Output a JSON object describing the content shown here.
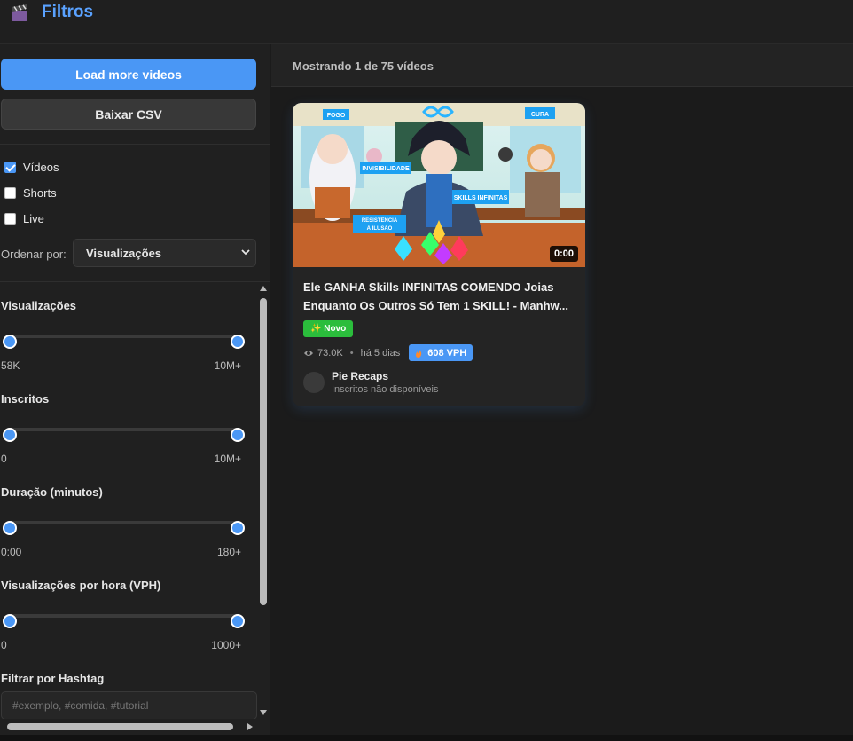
{
  "header": {
    "title": "Filtros",
    "icon": "clapperboard-icon"
  },
  "sidebar": {
    "load_more_label": "Load more videos",
    "download_csv_label": "Baixar CSV",
    "types": [
      {
        "label": "Vídeos",
        "checked": true
      },
      {
        "label": "Shorts",
        "checked": false
      },
      {
        "label": "Live",
        "checked": false
      }
    ],
    "sort": {
      "label": "Ordenar por:",
      "value": "Visualizações"
    },
    "filters": [
      {
        "title": "Visualizações",
        "min": "58K",
        "max": "10M+"
      },
      {
        "title": "Inscritos",
        "min": "0",
        "max": "10M+"
      },
      {
        "title": "Duração (minutos)",
        "min": "0:00",
        "max": "180+"
      },
      {
        "title": "Visualizações por hora (VPH)",
        "min": "0",
        "max": "1000+"
      }
    ],
    "hashtag": {
      "title": "Filtrar por Hashtag",
      "placeholder": "#exemplo, #comida, #tutorial"
    }
  },
  "main": {
    "status": "Mostrando 1 de 75 vídeos",
    "videos": [
      {
        "title": "Ele GANHA Skills INFINITAS COMENDO Joias Enquanto Os Outros Só Tem 1 SKILL! - Manhw...",
        "duration": "0:00",
        "badge": "✨ Novo",
        "views": "73.0K",
        "age": "há 5 dias",
        "vph": "608 VPH",
        "channel": "Pie Recaps",
        "subscribers": "Inscritos não disponíveis",
        "thumbnail_labels": [
          "FOGO",
          "CURA",
          "INVISIBILIDADE",
          "SKILLS INFINITAS",
          "RESISTÊNCIA À ILUSÃO"
        ]
      }
    ]
  },
  "colors": {
    "accent": "#4a97f5",
    "new_badge": "#2bbd3c",
    "background": "#1b1b1b"
  }
}
